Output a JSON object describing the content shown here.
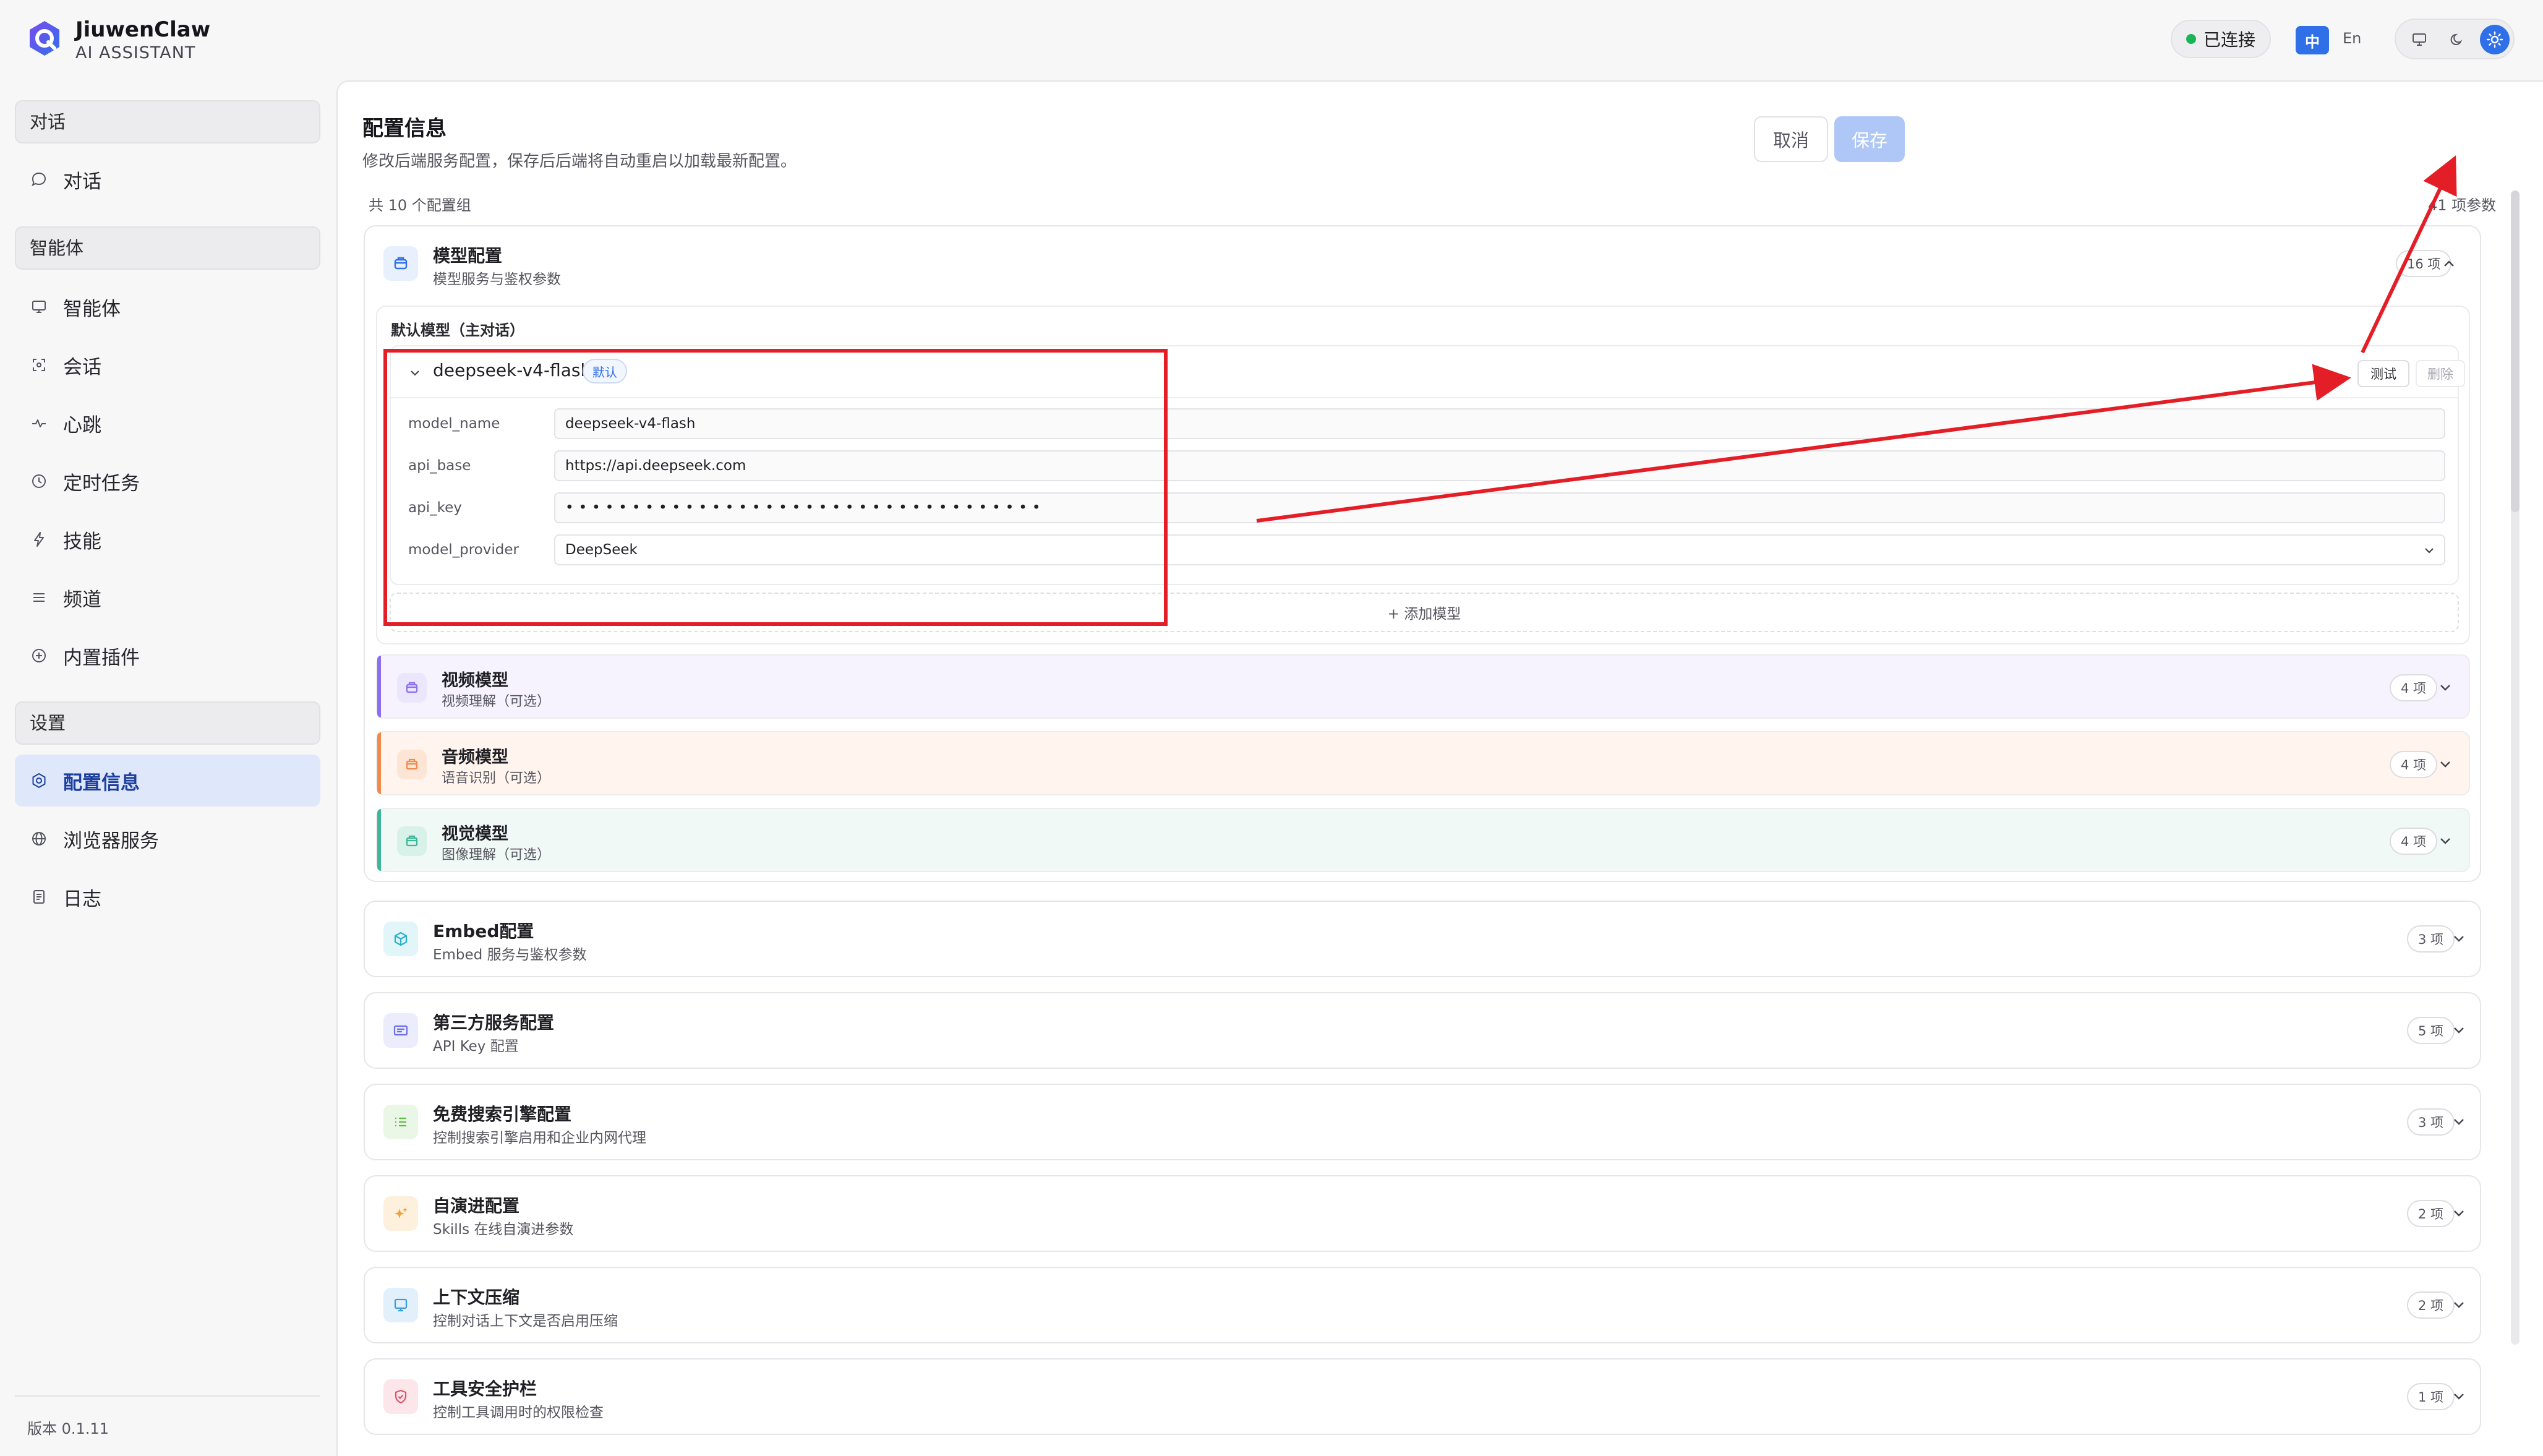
{
  "header": {
    "brand_title": "JiuwenClaw",
    "brand_subtitle": "AI ASSISTANT",
    "connection_status": "已连接",
    "lang_zh": "中",
    "lang_en": "En"
  },
  "sidebar": {
    "sections": [
      {
        "label": "对话",
        "items": [
          {
            "label": "对话",
            "icon": "chat-bubble-icon"
          }
        ]
      },
      {
        "label": "智能体",
        "items": [
          {
            "label": "智能体",
            "icon": "monitor-icon"
          },
          {
            "label": "会话",
            "icon": "session-icon"
          },
          {
            "label": "心跳",
            "icon": "pulse-icon"
          },
          {
            "label": "定时任务",
            "icon": "clock-icon"
          },
          {
            "label": "技能",
            "icon": "lightning-icon"
          },
          {
            "label": "频道",
            "icon": "menu-lines-icon"
          },
          {
            "label": "内置插件",
            "icon": "plus-circle-icon"
          }
        ]
      },
      {
        "label": "设置",
        "items": [
          {
            "label": "配置信息",
            "icon": "gear-icon",
            "active": true
          },
          {
            "label": "浏览器服务",
            "icon": "globe-icon"
          },
          {
            "label": "日志",
            "icon": "document-icon"
          }
        ]
      }
    ],
    "version": "版本 0.1.11"
  },
  "main": {
    "title": "配置信息",
    "description": "修改后端服务配置，保存后后端将自动重启以加载最新配置。",
    "cancel_label": "取消",
    "save_label": "保存",
    "group_count": "共 10 个配置组",
    "param_count": "41 项参数",
    "model_config": {
      "title": "模型配置",
      "subtitle": "模型服务与鉴权参数",
      "badge": "16 项",
      "default_group_label": "默认模型（主对话）",
      "model": {
        "name": "deepseek-v4-flash",
        "default_tag": "默认",
        "test_label": "测试",
        "delete_label": "删除",
        "fields": [
          {
            "label": "model_name",
            "value": "deepseek-v4-flash"
          },
          {
            "label": "api_base",
            "value": "https://api.deepseek.com"
          },
          {
            "label": "api_key",
            "value": "••••••••••••••••••••••••••••••••••••"
          },
          {
            "label": "model_provider",
            "value": "DeepSeek"
          }
        ]
      },
      "add_model_label": "+ 添加模型",
      "media": [
        {
          "title": "视频模型",
          "subtitle": "视频理解（可选）",
          "badge": "4 项",
          "color": "#8b6ef0",
          "bg": "#f6f3fe"
        },
        {
          "title": "音频模型",
          "subtitle": "语音识别（可选）",
          "badge": "4 项",
          "color": "#f08a4b",
          "bg": "#fff5ee"
        },
        {
          "title": "视觉模型",
          "subtitle": "图像理解（可选）",
          "badge": "4 项",
          "color": "#3fb59a",
          "bg": "#f0f9f6"
        }
      ]
    },
    "groups": [
      {
        "title": "Embed配置",
        "subtitle": "Embed 服务与鉴权参数",
        "badge": "3 项",
        "icon": "cube-icon",
        "color": "#2bb0c9"
      },
      {
        "title": "第三方服务配置",
        "subtitle": "API Key 配置",
        "badge": "5 项",
        "icon": "card-icon",
        "color": "#6b6ee8"
      },
      {
        "title": "免费搜索引擎配置",
        "subtitle": "控制搜索引擎启用和企业内网代理",
        "badge": "3 项",
        "icon": "list-icon",
        "color": "#5cbf4a"
      },
      {
        "title": "自演进配置",
        "subtitle": "Skills 在线自演进参数",
        "badge": "2 项",
        "icon": "sparkle-icon",
        "color": "#f0a23a"
      },
      {
        "title": "上下文压缩",
        "subtitle": "控制对话上下文是否启用压缩",
        "badge": "2 项",
        "icon": "screen-icon",
        "color": "#3b9be0"
      },
      {
        "title": "工具安全护栏",
        "subtitle": "控制工具调用时的权限检查",
        "badge": "1 项",
        "icon": "shield-icon",
        "color": "#e0506a"
      }
    ]
  },
  "colors": {
    "accent": "#2f6fe8",
    "annotation_red": "#e41e26",
    "connected_green": "#19b455"
  }
}
